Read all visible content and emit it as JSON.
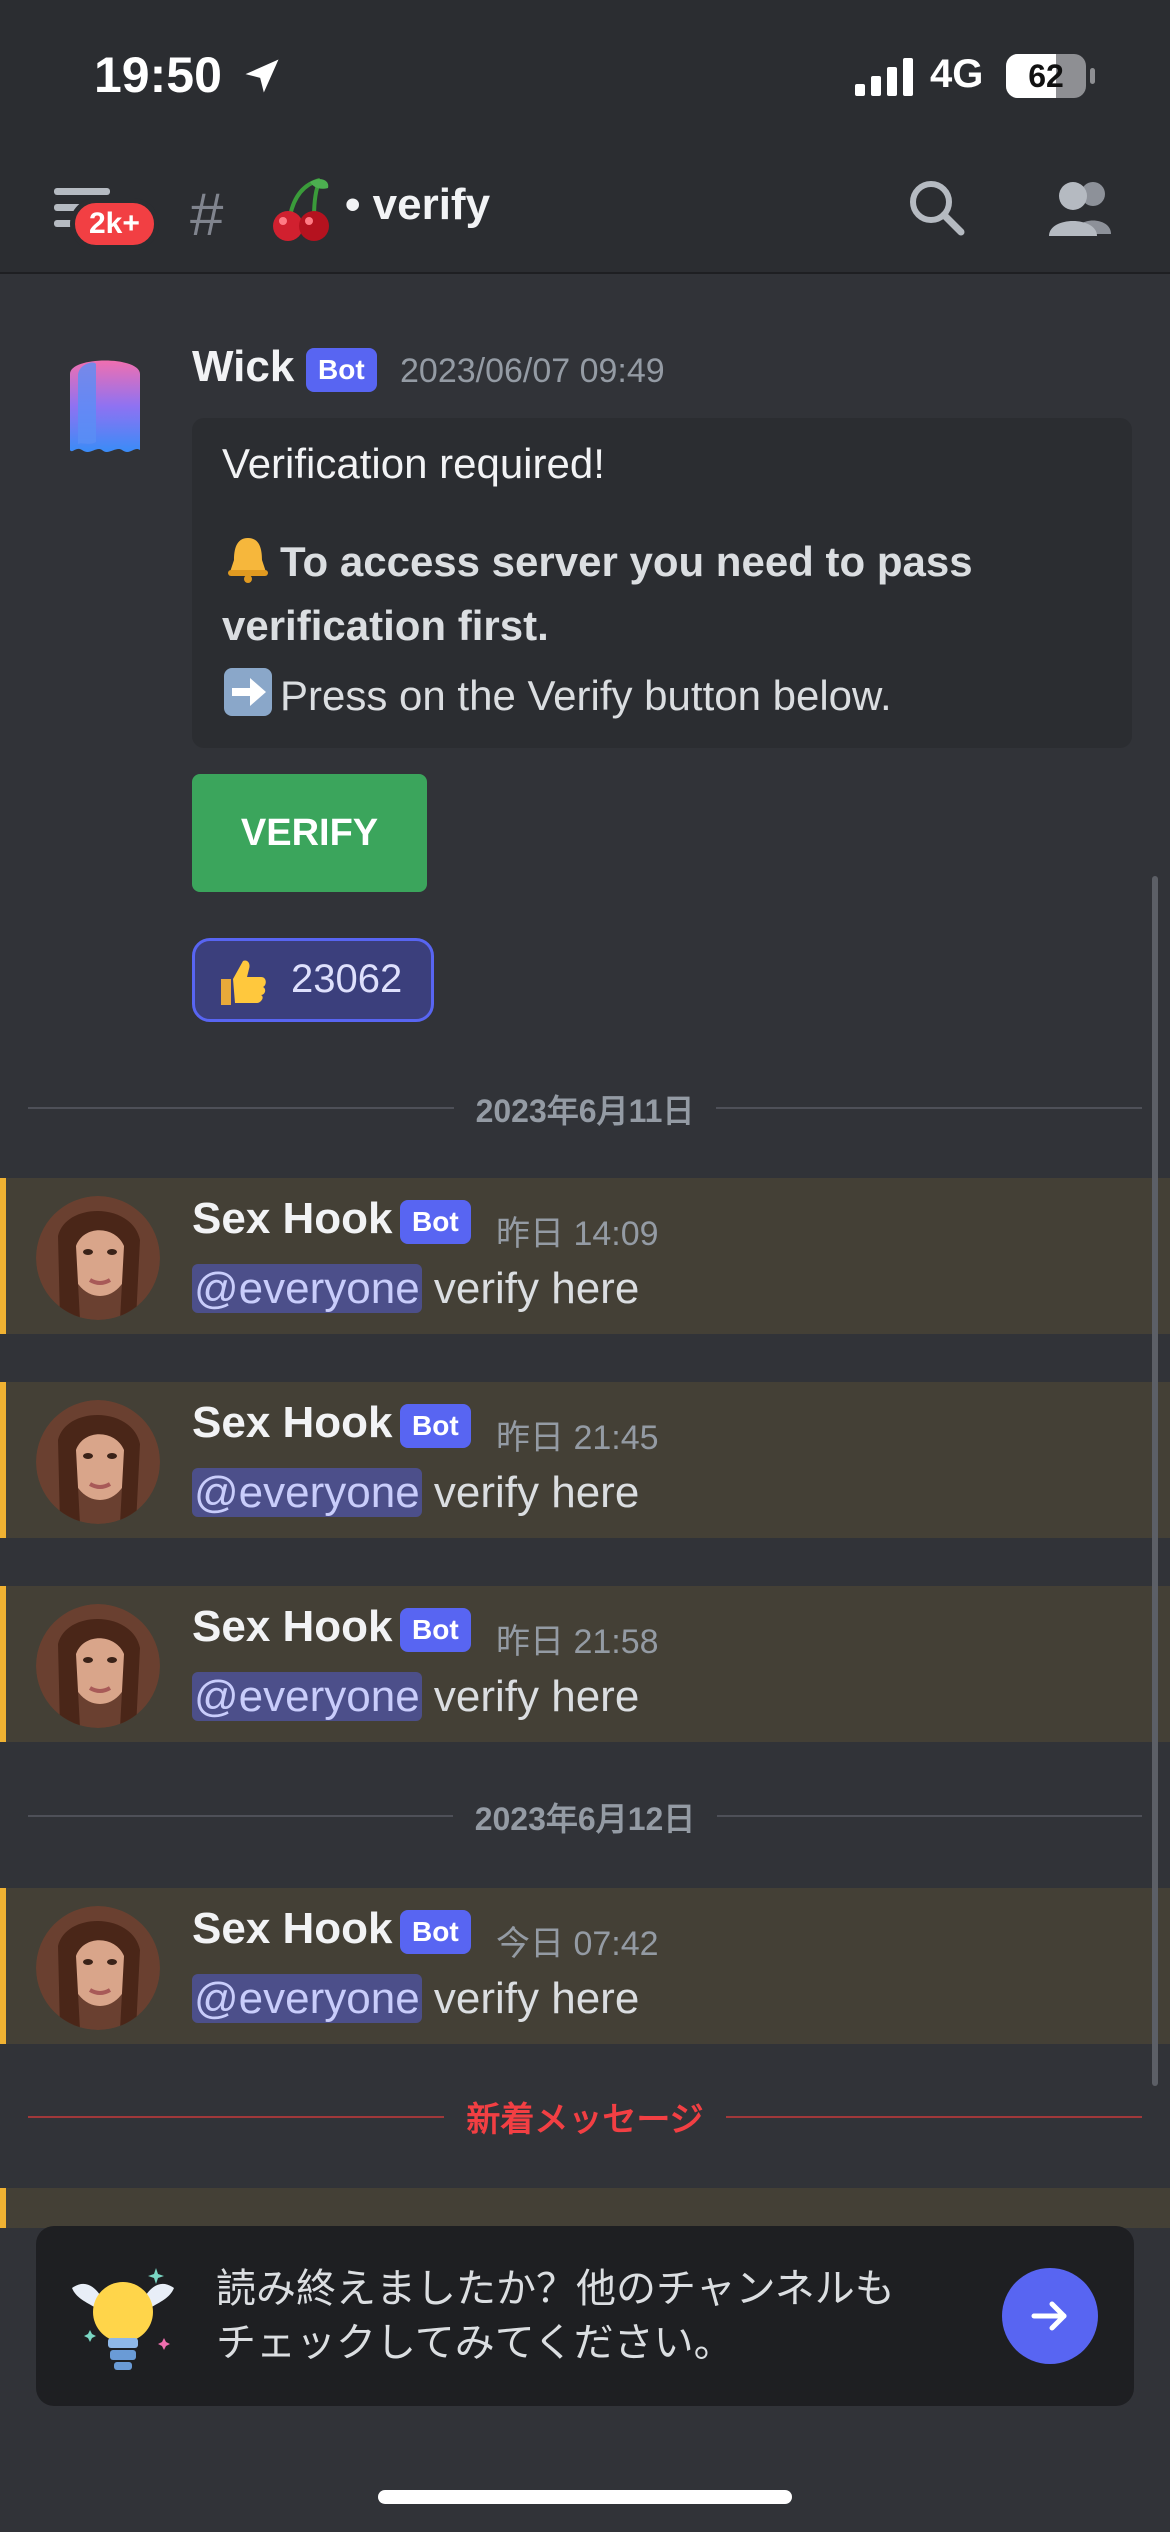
{
  "status_bar": {
    "time": "19:50",
    "network": "4G",
    "battery": "62",
    "battery_level": 0.62
  },
  "header": {
    "notification_badge": "2k+",
    "hash": "#",
    "channel_name": "• verify"
  },
  "bot_message": {
    "author": "Wick",
    "tag": "Bot",
    "timestamp": "2023/06/07 09:49",
    "embed": {
      "title": "Verification required!",
      "line2": "To access server you need to pass verification first.",
      "line3": "Press on the Verify button below."
    },
    "button_label": "VERIFY",
    "reaction_count": "23062"
  },
  "dividers": {
    "date1": "2023年6月11日",
    "date2": "2023年6月12日",
    "new_messages": "新着メッセージ"
  },
  "messages": [
    {
      "author": "Sex Hook",
      "tag": "Bot",
      "timestamp": "昨日 14:09",
      "mention": "@everyone",
      "text": " verify here"
    },
    {
      "author": "Sex Hook",
      "tag": "Bot",
      "timestamp": "昨日 21:45",
      "mention": "@everyone",
      "text": " verify here"
    },
    {
      "author": "Sex Hook",
      "tag": "Bot",
      "timestamp": "昨日 21:58",
      "mention": "@everyone",
      "text": " verify here"
    },
    {
      "author": "Sex Hook",
      "tag": "Bot",
      "timestamp": "今日 07:42",
      "mention": "@everyone",
      "text": " verify here"
    }
  ],
  "prompt": {
    "text_line1": "読み終えましたか？他のチャンネルも",
    "text_line2": "チェックしてみてください。"
  },
  "colors": {
    "background": "#313338",
    "bot_tag": "#5865f2",
    "verify_green": "#3ba55c",
    "mention_highlight": "#f0b232",
    "new_divider": "#f23f43"
  },
  "icons": [
    "location-arrow-icon",
    "signal-icon",
    "menu-icon",
    "hash-icon",
    "cherry-icon",
    "search-icon",
    "members-icon",
    "bell-icon",
    "arrow-right-emoji-icon",
    "thumbs-up-icon",
    "lightbulb-icon",
    "arrow-right-icon"
  ]
}
